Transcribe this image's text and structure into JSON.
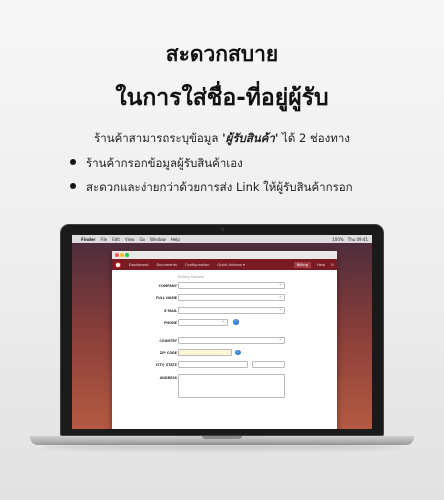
{
  "headline": {
    "line1": "สะดวกสบาย",
    "line2": "ในการใส่ชื่อ-ที่อยู่ผู้รับ"
  },
  "intro": {
    "before": "ร้านค้าสามารถระบุข้อมูล ",
    "emphasis": "'ผู้รับสินค้า'",
    "after": " ได้ 2 ช่องทาง"
  },
  "bullets": [
    "ร้านค้ากรอกข้อมูลผู้รับสินค้าเอง",
    "สะดวกและง่ายกว่าด้วยการส่ง Link ให้ผู้รับสินค้ากรอก"
  ],
  "macbar": {
    "app": "Finder",
    "menus": [
      "File",
      "Edit",
      "View",
      "Go",
      "Window",
      "Help"
    ],
    "battery": "100%",
    "clock": "Thu 09:41"
  },
  "app": {
    "nav": {
      "items": [
        "Dashboard",
        "Documents",
        "Configuration",
        "Quick Actions ▾"
      ],
      "right": [
        "Billing",
        "Help"
      ]
    },
    "section_title": "Billing Details",
    "fields": {
      "company": "COMPANY",
      "full_name": "FULL NAME",
      "email": "E-MAIL",
      "phone": "PHONE",
      "country": "COUNTRY",
      "zip": "ZIP CODE",
      "city_state": "CITY, STATE",
      "address": "ADDRESS"
    }
  },
  "colors": {
    "nav_bg": "#7a1a22",
    "info": "#3a86d8",
    "zip_highlight": "#fdf6d4"
  }
}
